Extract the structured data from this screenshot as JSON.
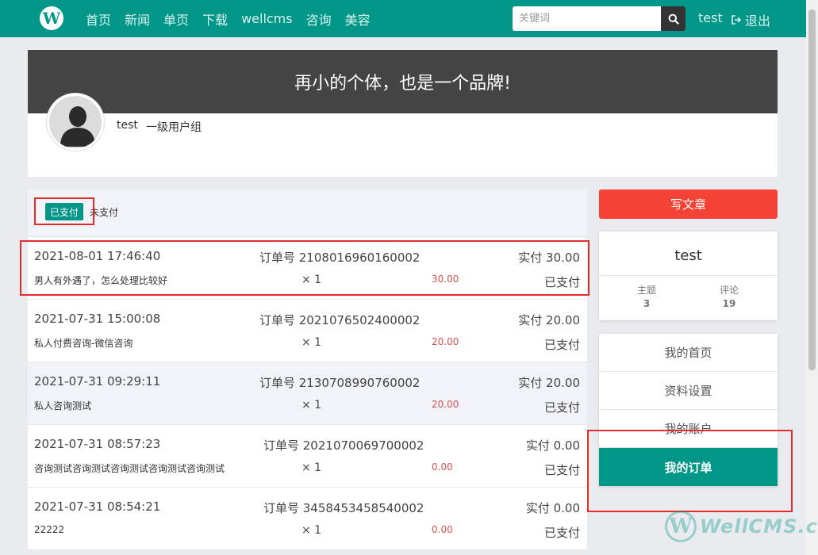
{
  "nav": {
    "logo_letter": "W",
    "links": [
      "首页",
      "新闻",
      "单页",
      "下载",
      "wellcms",
      "咨询",
      "美容"
    ],
    "search_placeholder": "关键词",
    "user": "test",
    "logout": "退出"
  },
  "banner": {
    "slogan": "再小的个体，也是一个品牌!"
  },
  "profile": {
    "name": "test",
    "group": "一级用户组"
  },
  "tabs": {
    "active": "已支付",
    "inactive": "未支付"
  },
  "orders": [
    {
      "time": "2021-08-01 17:46:40",
      "order_no": "订单号 2108016960160002",
      "paid": "实付 30.00",
      "title": "男人有外遇了，怎么处理比较好",
      "qty": "× 1",
      "amount": "30.00",
      "status": "已支付"
    },
    {
      "time": "2021-07-31 15:00:08",
      "order_no": "订单号 2021076502400002",
      "paid": "实付 20.00",
      "title": "私人付费咨询-微信咨询",
      "qty": "× 1",
      "amount": "20.00",
      "status": "已支付"
    },
    {
      "time": "2021-07-31 09:29:11",
      "order_no": "订单号 2130708990760002",
      "paid": "实付 20.00",
      "title": "私人咨询测试",
      "qty": "× 1",
      "amount": "20.00",
      "status": "已支付"
    },
    {
      "time": "2021-07-31 08:57:23",
      "order_no": "订单号 2021070069700002",
      "paid": "实付 0.00",
      "title": "咨询测试咨询测试咨询测试咨询测试咨询测试",
      "qty": "× 1",
      "amount": "0.00",
      "status": "已支付"
    },
    {
      "time": "2021-07-31 08:54:21",
      "order_no": "订单号 3458453458540002",
      "paid": "实付 0.00",
      "title": "22222",
      "qty": "× 1",
      "amount": "0.00",
      "status": "已支付"
    }
  ],
  "sidebar": {
    "write_button": "写文章",
    "user_name": "test",
    "topics_label": "主题",
    "topics_count": "3",
    "comments_label": "评论",
    "comments_count": "19",
    "menu": [
      "我的首页",
      "资料设置",
      "我的账户",
      "我的订单"
    ]
  },
  "watermark": {
    "logo_letter": "W",
    "text": "WellCMS.cn"
  },
  "colors": {
    "primary": "#009688",
    "danger": "#f44336",
    "banner": "#444444",
    "highlight": "#e32d2d"
  }
}
